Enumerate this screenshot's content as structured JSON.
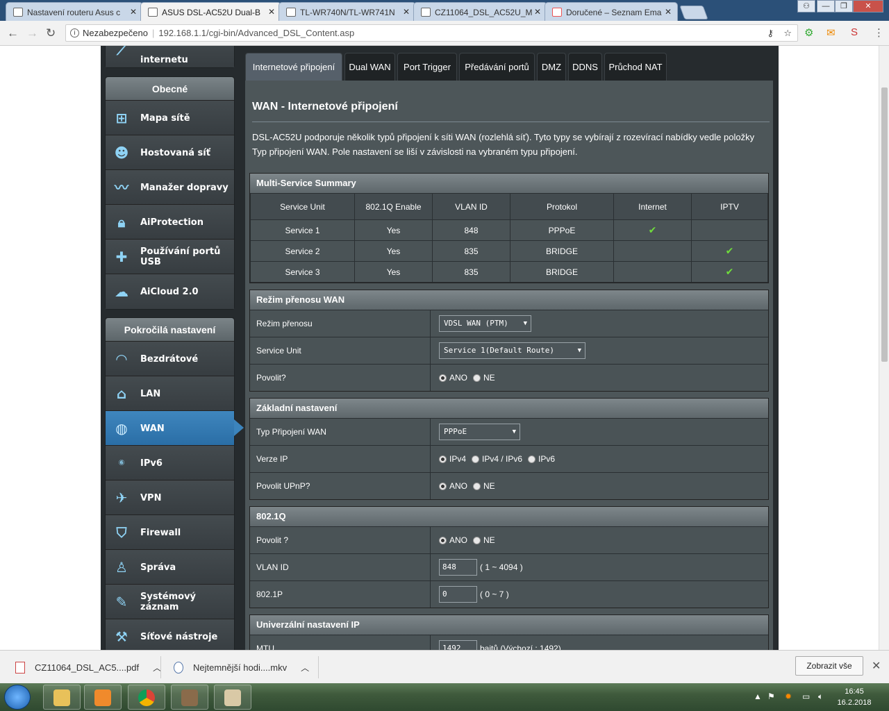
{
  "browser": {
    "tabs": [
      {
        "title": "Nastavení routeru Asus c",
        "active": false
      },
      {
        "title": "ASUS DSL-AC52U Dual-B",
        "active": true
      },
      {
        "title": "TL-WR740N/TL-WR741N",
        "active": false
      },
      {
        "title": "CZ11064_DSL_AC52U_M",
        "active": false
      },
      {
        "title": "Doručené – Seznam Ema",
        "active": false
      }
    ],
    "address": {
      "security": "Nezabezpečeno",
      "url": "192.168.1.1/cgi-bin/Advanced_DSL_Content.asp"
    }
  },
  "sidebar": {
    "top_item": "internetu",
    "general": {
      "heading": "Obecné",
      "items": [
        {
          "label": "Mapa sítě",
          "icon": "network-map-icon"
        },
        {
          "label": "Hostovaná síť",
          "icon": "guest-network-icon"
        },
        {
          "label": "Manažer dopravy",
          "icon": "traffic-manager-icon"
        },
        {
          "label": "AiProtection",
          "icon": "lock-icon"
        },
        {
          "label": "Používání portů USB",
          "icon": "puzzle-icon"
        },
        {
          "label": "AiCloud 2.0",
          "icon": "cloud-icon"
        }
      ]
    },
    "advanced": {
      "heading": "Pokročilá nastavení",
      "items": [
        {
          "label": "Bezdrátové",
          "icon": "wifi-icon"
        },
        {
          "label": "LAN",
          "icon": "home-icon"
        },
        {
          "label": "WAN",
          "icon": "globe-icon",
          "active": true
        },
        {
          "label": "IPv6",
          "icon": "ipv6-icon"
        },
        {
          "label": "VPN",
          "icon": "vpn-icon"
        },
        {
          "label": "Firewall",
          "icon": "shield-icon"
        },
        {
          "label": "Správa",
          "icon": "user-icon"
        },
        {
          "label": "Systémový záznam",
          "icon": "log-icon"
        },
        {
          "label": "Síťové nástroje",
          "icon": "tools-icon"
        }
      ]
    }
  },
  "tabs": [
    "Internetové připojení",
    "Dual WAN",
    "Port Trigger",
    "Předávání portů",
    "DMZ",
    "DDNS",
    "Průchod NAT"
  ],
  "content": {
    "title": "WAN - Internetové připojení",
    "description": "DSL-AC52U podporuje několik typů připojení k síti WAN (rozlehlá síť). Tyto typy se vybírají z rozevírací nabídky vedle položky Typ připojení WAN. Pole nastavení se liší v závislosti na vybraném typu připojení.",
    "summary": {
      "heading": "Multi-Service Summary",
      "columns": [
        "Service Unit",
        "802.1Q Enable",
        "VLAN ID",
        "Protokol",
        "Internet",
        "IPTV"
      ],
      "rows": [
        {
          "unit": "Service 1",
          "enable": "Yes",
          "vlan": "848",
          "protocol": "PPPoE",
          "internet": true,
          "iptv": false
        },
        {
          "unit": "Service 2",
          "enable": "Yes",
          "vlan": "835",
          "protocol": "BRIDGE",
          "internet": false,
          "iptv": true
        },
        {
          "unit": "Service 3",
          "enable": "Yes",
          "vlan": "835",
          "protocol": "BRIDGE",
          "internet": false,
          "iptv": true
        }
      ]
    },
    "transfer": {
      "heading": "Režim přenosu WAN",
      "mode_label": "Režim přenosu",
      "mode_value": "VDSL WAN (PTM)",
      "unit_label": "Service Unit",
      "unit_value": "Service 1(Default Route)",
      "enable_label": "Povolit?",
      "yes": "ANO",
      "no": "NE"
    },
    "basic": {
      "heading": "Základní nastavení",
      "type_label": "Typ Připojení WAN",
      "type_value": "PPPoE",
      "ip_label": "Verze IP",
      "ip_opt1": "IPv4",
      "ip_opt2": "IPv4 / IPv6",
      "ip_opt3": "IPv6",
      "upnp_label": "Povolit UPnP?",
      "yes": "ANO",
      "no": "NE"
    },
    "dot1q": {
      "heading": "802.1Q",
      "enable_label": "Povolit ?",
      "yes": "ANO",
      "no": "NE",
      "vlan_label": "VLAN ID",
      "vlan_value": "848",
      "vlan_range": "( 1 ~ 4094 )",
      "prio_label": "802.1P",
      "prio_value": "0",
      "prio_range": "( 0 ~ 7 )"
    },
    "ip": {
      "heading": "Univerzální nastavení IP",
      "mtu_label": "MTU",
      "mtu_value": "1492",
      "mtu_hint": "bajtů (Výchozí : 1492)"
    }
  },
  "downloads": {
    "items": [
      "CZ11064_DSL_AC5....pdf",
      "Nejtemnější hodi....mkv"
    ],
    "show_all": "Zobrazit vše"
  },
  "taskbar": {
    "time": "16:45",
    "date": "16.2.2018"
  }
}
